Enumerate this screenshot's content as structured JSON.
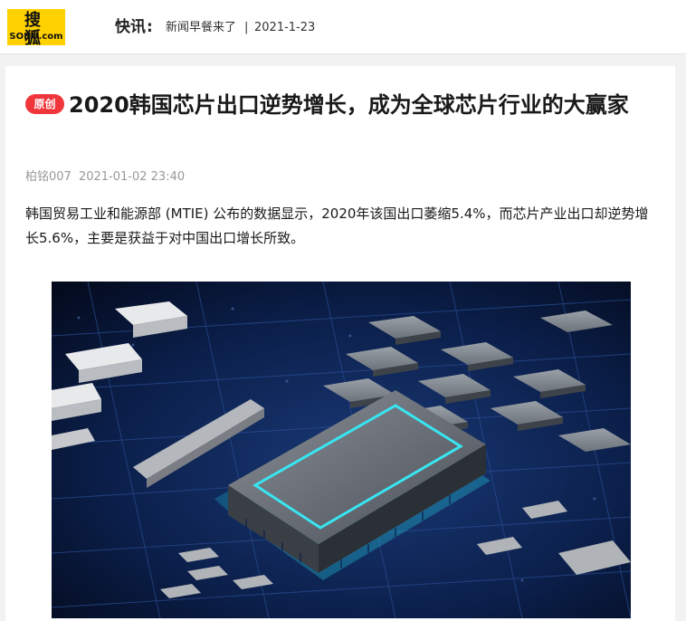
{
  "header": {
    "logo_text": "搜 狐",
    "logo_sub": "SOHU.com",
    "flash_label": "快讯",
    "flash_colon": ":",
    "flash_text": "新闻早餐来了",
    "flash_sep": "|",
    "flash_date": "2021-1-23"
  },
  "article": {
    "badge": "原创",
    "title": "2020韩国芯片出口逆势增长，成为全球芯片行业的大赢家",
    "author": "柏铭007",
    "datetime": "2021-01-02 23:40",
    "paragraph": "韩国贸易工业和能源部 (MTIE) 公布的数据显示，2020年该国出口萎缩5.4%，而芯片产业出口却逆势增长5.6%，主要是获益于对中国出口增长所致。"
  },
  "colors": {
    "brand_yellow": "#ffd100",
    "badge_red": "#f0363a",
    "chip_glow": "#2fe3f0",
    "board_blue": "#0b1f4a"
  }
}
